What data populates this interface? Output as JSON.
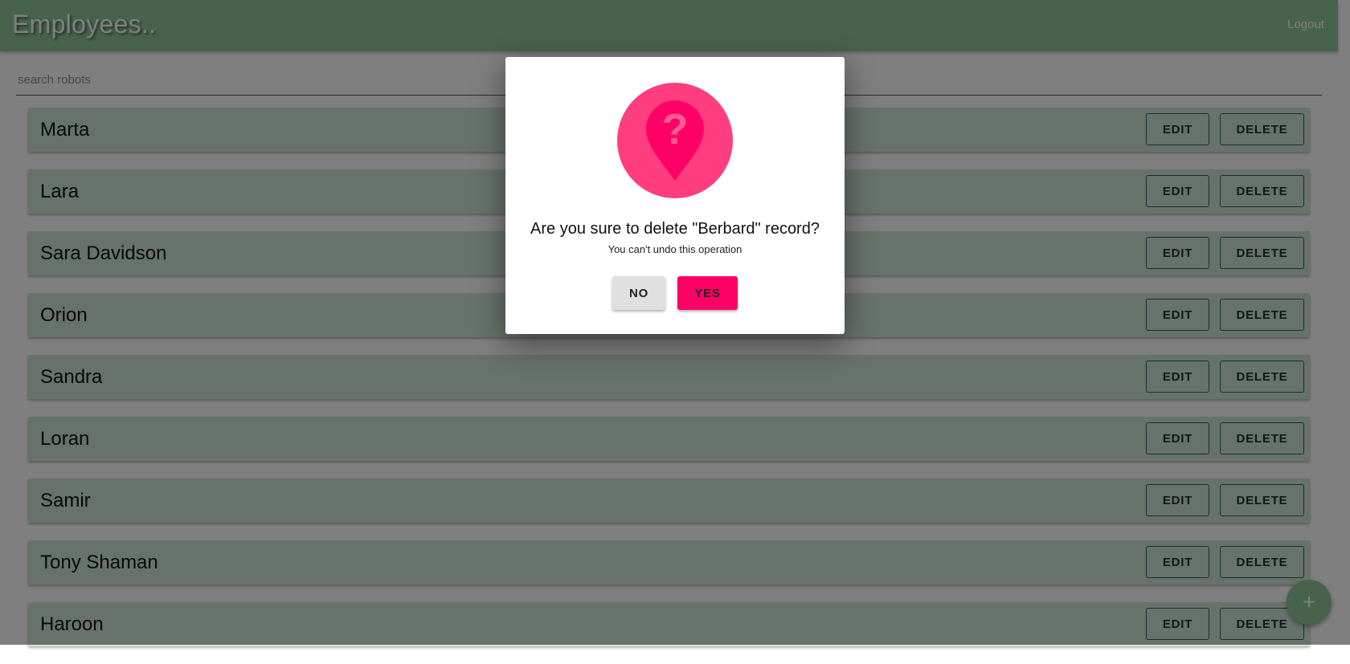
{
  "appbar": {
    "title": "Employees..",
    "logout_label": "Logout"
  },
  "search": {
    "placeholder": "search robots",
    "value": ""
  },
  "employees": [
    {
      "name": "Marta",
      "edit_label": "EDIT",
      "delete_label": "DELETE"
    },
    {
      "name": "Lara",
      "edit_label": "EDIT",
      "delete_label": "DELETE"
    },
    {
      "name": "Sara Davidson",
      "edit_label": "EDIT",
      "delete_label": "DELETE"
    },
    {
      "name": "Orion",
      "edit_label": "EDIT",
      "delete_label": "DELETE"
    },
    {
      "name": "Sandra",
      "edit_label": "EDIT",
      "delete_label": "DELETE"
    },
    {
      "name": "Loran",
      "edit_label": "EDIT",
      "delete_label": "DELETE"
    },
    {
      "name": "Samir",
      "edit_label": "EDIT",
      "delete_label": "DELETE"
    },
    {
      "name": "Tony Shaman",
      "edit_label": "EDIT",
      "delete_label": "DELETE"
    },
    {
      "name": "Haroon",
      "edit_label": "EDIT",
      "delete_label": "DELETE"
    }
  ],
  "fab": {
    "label": "+",
    "icon": "plus-icon"
  },
  "dialog": {
    "icon": "question-marker-icon",
    "title": "Are you sure to delete \"Berbard\" record?",
    "subtitle": "You can't undo this operation",
    "no_label": "NO",
    "yes_label": "YES"
  },
  "colors": {
    "appbar": "#8fc79a",
    "row_background": "#cfe6d4",
    "dialog_icon_circle": "#ff3d7f",
    "dialog_icon_marker": "#ff0066",
    "yes_button": "#ff0066",
    "no_button": "#e0e0e0"
  }
}
